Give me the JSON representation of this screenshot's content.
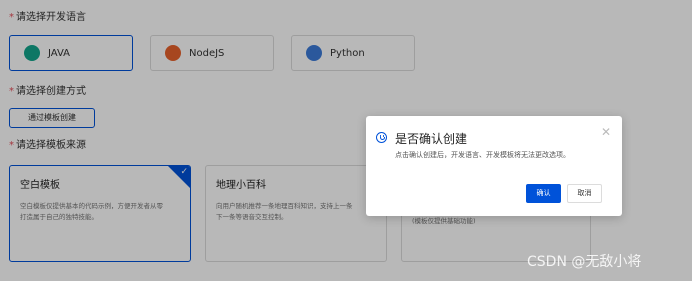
{
  "language_section": {
    "label": "请选择开发语言",
    "options": [
      {
        "label": "JAVA",
        "icon": "java-icon",
        "selected": true
      },
      {
        "label": "NodeJS",
        "icon": "nodejs-icon",
        "selected": false
      },
      {
        "label": "Python",
        "icon": "python-icon",
        "selected": false
      }
    ]
  },
  "method_section": {
    "label": "请选择创建方式",
    "button_label": "通过模板创建"
  },
  "template_section": {
    "label": "请选择模板来源",
    "cards": [
      {
        "title": "空白模板",
        "desc_lines": [
          "空白模板仅提供基本的代码示例，方便开发者从零",
          "打造属于自己的独特技能。"
        ],
        "selected": true
      },
      {
        "title": "地理小百科",
        "desc_lines": [
          "向用户随机推荐一条地理百科知识，支持上一条",
          "下一条等语音交互控制。"
        ],
        "selected": false
      },
      {
        "title": "",
        "desc_lines": [
          "(模板仅提供基础功能)"
        ],
        "selected": false
      }
    ]
  },
  "dialog": {
    "title": "是否确认创建",
    "content": "点击确认创建后，开发语言、开发模板将无法更改选项。",
    "confirm_label": "确认",
    "cancel_label": "取消"
  },
  "watermark": "CSDN @无敌小将",
  "colors": {
    "primary": "#0052d9",
    "required": "#e34d59",
    "overlay": "rgba(0,0,0,0.28)"
  }
}
